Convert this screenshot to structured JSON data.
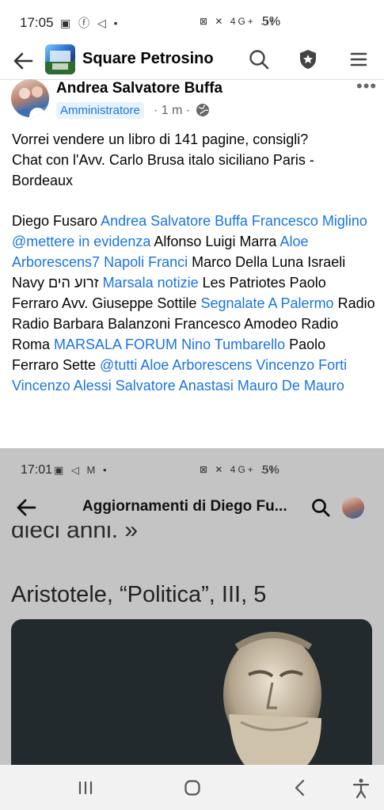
{
  "status_bar": {
    "time": "17:05",
    "left_icons": "▣ ⓕ ◁ •",
    "signal": "⊠ ✕ 4G+ .ıl",
    "battery": "5%"
  },
  "header": {
    "title": "Square Petrosino",
    "icons": [
      "back-arrow-icon",
      "search-icon",
      "shield-star-icon",
      "menu-icon"
    ]
  },
  "post": {
    "author": "Andrea Salvatore Buffa",
    "role_badge": "Amministratore",
    "time": "· 1 m ·",
    "more": "•••",
    "body": [
      "Vorrei vendere un libro di 141 pagine, consigli?",
      "Chat con l'Avv. Carlo Brusa italo siciliano Paris -",
      "Bordeaux"
    ],
    "tags": [
      {
        "text": "Diego Fusaro ",
        "link": false
      },
      {
        "text": "Andrea Salvatore Buffa",
        "link": true
      },
      {
        "text": "  ",
        "link": false
      },
      {
        "text": "Francesco Miglino",
        "link": true
      },
      {
        "text": "  ",
        "link": false
      },
      {
        "text": "@mettere in evidenza",
        "link": true
      },
      {
        "text": "  Alfonso Luigi Marra  ",
        "link": false
      },
      {
        "text": "Aloe Arborescens7",
        "link": true
      },
      {
        "text": "  ",
        "link": false
      },
      {
        "text": "Napoli Franci",
        "link": true
      },
      {
        "text": "  Marco Della Luna  Israeli Navy זרוע הים  ",
        "link": false
      },
      {
        "text": "Marsala notizie",
        "link": true
      },
      {
        "text": " Les Patriotes  Paolo Ferraro  Avv. Giuseppe Sottile ",
        "link": false
      },
      {
        "text": "Segnalate A Palermo",
        "link": true
      },
      {
        "text": " Radio Radio  Barbara Balanzoni  Francesco Amodeo  Radio Roma ",
        "link": false
      },
      {
        "text": "MARSALA FORUM",
        "link": true
      },
      {
        "text": "  ",
        "link": false
      },
      {
        "text": "Nino Tumbarello",
        "link": true
      },
      {
        "text": "  Paolo Ferraro Sette  ",
        "link": false
      },
      {
        "text": "@tutti Aloe Arborescens Vincenzo Forti Vincenzo Alessi Salvatore Anastasi Mauro De Mauro",
        "link": true
      }
    ]
  },
  "embedded_screenshot": {
    "time": "17:01",
    "left_icons": "▣ ◁ M •",
    "signal": "⊠ ✕ 4G+ .ıl",
    "battery": "5%",
    "title": "Aggiornamenti di Diego Fu...",
    "clipped_text": "dieci anni. »",
    "quote": "Aristotele, “Politica”, III, 5"
  },
  "nav_bar": {
    "icons": [
      "recent-apps-icon",
      "home-icon",
      "back-icon",
      "accessibility-icon"
    ]
  },
  "colors": {
    "link": "#1b74e4",
    "badge_bg": "#e7f3ff",
    "muted": "#65676b"
  }
}
